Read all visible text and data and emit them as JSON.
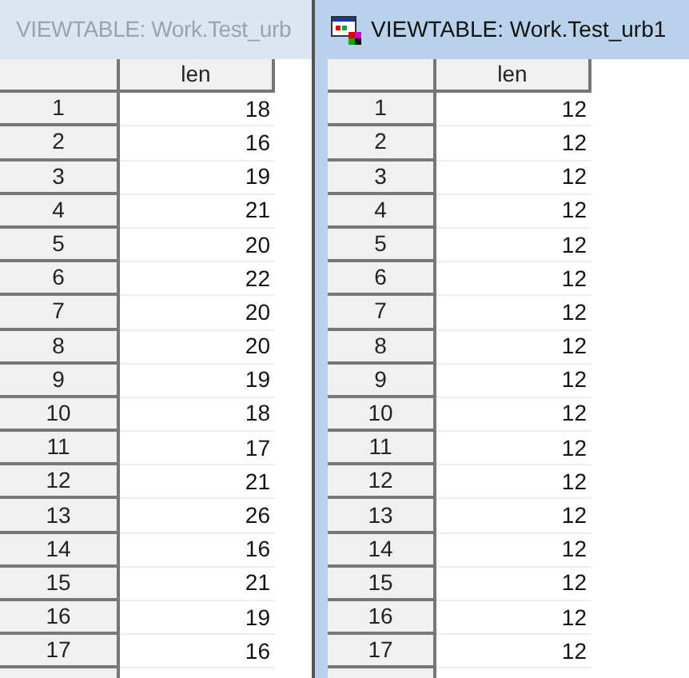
{
  "windows": [
    {
      "title": "VIEWTABLE: Work.Test_urb",
      "active": false,
      "column": "len",
      "rows": [
        {
          "n": "1",
          "len": "18"
        },
        {
          "n": "2",
          "len": "16"
        },
        {
          "n": "3",
          "len": "19"
        },
        {
          "n": "4",
          "len": "21"
        },
        {
          "n": "5",
          "len": "20"
        },
        {
          "n": "6",
          "len": "22"
        },
        {
          "n": "7",
          "len": "20"
        },
        {
          "n": "8",
          "len": "20"
        },
        {
          "n": "9",
          "len": "19"
        },
        {
          "n": "10",
          "len": "18"
        },
        {
          "n": "11",
          "len": "17"
        },
        {
          "n": "12",
          "len": "21"
        },
        {
          "n": "13",
          "len": "26"
        },
        {
          "n": "14",
          "len": "16"
        },
        {
          "n": "15",
          "len": "21"
        },
        {
          "n": "16",
          "len": "19"
        },
        {
          "n": "17",
          "len": "16"
        }
      ]
    },
    {
      "title": "VIEWTABLE: Work.Test_urb1",
      "active": true,
      "column": "len",
      "rows": [
        {
          "n": "1",
          "len": "12"
        },
        {
          "n": "2",
          "len": "12"
        },
        {
          "n": "3",
          "len": "12"
        },
        {
          "n": "4",
          "len": "12"
        },
        {
          "n": "5",
          "len": "12"
        },
        {
          "n": "6",
          "len": "12"
        },
        {
          "n": "7",
          "len": "12"
        },
        {
          "n": "8",
          "len": "12"
        },
        {
          "n": "9",
          "len": "12"
        },
        {
          "n": "10",
          "len": "12"
        },
        {
          "n": "11",
          "len": "12"
        },
        {
          "n": "12",
          "len": "12"
        },
        {
          "n": "13",
          "len": "12"
        },
        {
          "n": "14",
          "len": "12"
        },
        {
          "n": "15",
          "len": "12"
        },
        {
          "n": "16",
          "len": "12"
        },
        {
          "n": "17",
          "len": "12"
        }
      ]
    }
  ]
}
